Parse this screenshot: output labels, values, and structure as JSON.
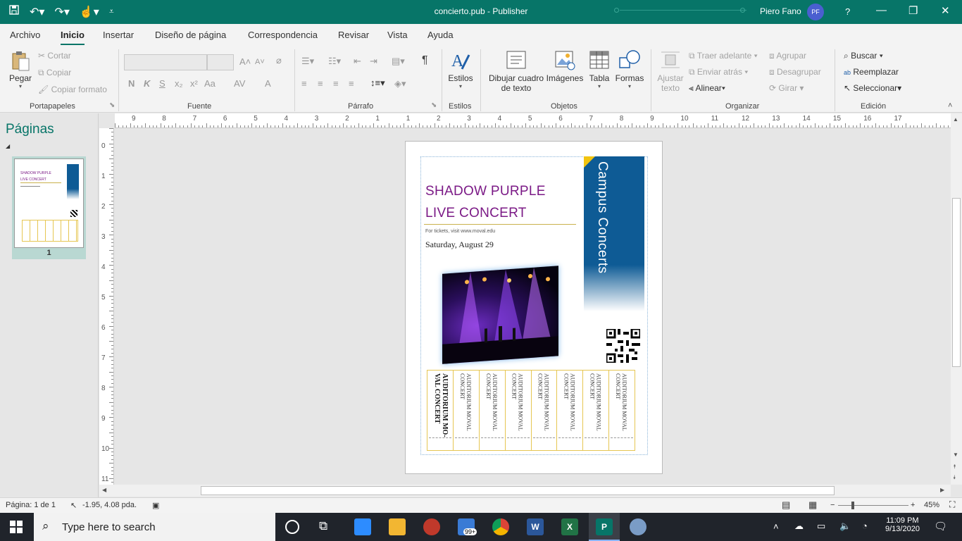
{
  "window": {
    "title": "concierto.pub  -  Publisher",
    "user_name": "Piero Fano",
    "user_initials": "PF",
    "help": "?",
    "minimize": "—",
    "restore": "❐",
    "close": "✕"
  },
  "tabs": [
    "Archivo",
    "Inicio",
    "Insertar",
    "Diseño de página",
    "Correspondencia",
    "Revisar",
    "Vista",
    "Ayuda"
  ],
  "ribbon": {
    "portapapeles": {
      "label": "Portapapeles",
      "pegar": "Pegar",
      "cortar": "Cortar",
      "copiar": "Copiar",
      "copiar_formato": "Copiar formato"
    },
    "fuente": {
      "label": "Fuente",
      "bold": "N",
      "italic": "K",
      "underline": "S",
      "sub": "x₂",
      "sup": "x²",
      "case": "Aa",
      "spacing": "AV",
      "color": "A"
    },
    "parrafo": {
      "label": "Párrafo",
      "pilcrow": "¶"
    },
    "estilos": {
      "label": "Estilos",
      "button": "Estilos"
    },
    "objetos": {
      "label": "Objetos",
      "dibujar": "Dibujar cuadro",
      "dibujar2": "de texto",
      "imagenes": "Imágenes",
      "tabla": "Tabla",
      "formas": "Formas"
    },
    "organizar": {
      "label": "Organizar",
      "ajustar": "Ajustar",
      "ajustar2": "texto",
      "traer": "Traer adelante",
      "enviar": "Enviar atrás",
      "alinear": "Alinear",
      "agrupar": "Agrupar",
      "desagrupar": "Desagrupar",
      "girar": "Girar"
    },
    "edicion": {
      "label": "Edición",
      "buscar": "Buscar",
      "reemplazar": "Reemplazar",
      "seleccionar": "Seleccionar"
    }
  },
  "pages_panel": {
    "title": "Páginas",
    "thumb_number": "1"
  },
  "ruler": {
    "h_labels": [
      "9",
      "8",
      "7",
      "6",
      "5",
      "4",
      "3",
      "2",
      "1",
      "1",
      "2",
      "3",
      "4",
      "5",
      "6",
      "7",
      "8",
      "9",
      "10",
      "11",
      "12",
      "13",
      "14",
      "15",
      "16",
      "17"
    ],
    "v_labels": [
      "0",
      "1",
      "2",
      "3",
      "4",
      "5",
      "6",
      "7",
      "8",
      "9",
      "10",
      "11"
    ]
  },
  "document": {
    "banner": "Campus Concerts",
    "headline1": "SHADOW PURPLE",
    "headline2": "LIVE CONCERT",
    "url_line": "For tickets, visit www.moval.edu",
    "date": "Saturday, August 29",
    "ticket_first": "AUDITORIUM MO-VAL CONCERT",
    "tickets": [
      "AUDITORIUM MOVAL CONCERT",
      "AUDITORIUM MOVAL CONCERT",
      "AUDITORIUM MOVAL CONCERT",
      "AUDITORIUM MOVAL CONCERT",
      "AUDITORIUM MOVAL CONCERT",
      "AUDITORIUM MOVAL CONCERT",
      "AUDITORIUM MOVAL CONCERT"
    ]
  },
  "status": {
    "page": "Página: 1 de 1",
    "position": "-1.95, 4.08 pda.",
    "zoom": "45%",
    "zoom_fraction": 0.45
  },
  "taskbar": {
    "search_placeholder": "Type here to search",
    "time": "11:09 PM",
    "date": "9/13/2020",
    "badge": "99+"
  },
  "colors": {
    "accent": "#077568",
    "headline": "#7b1a86",
    "banner": "#0e5b95",
    "ticket_border": "#e6c652"
  }
}
